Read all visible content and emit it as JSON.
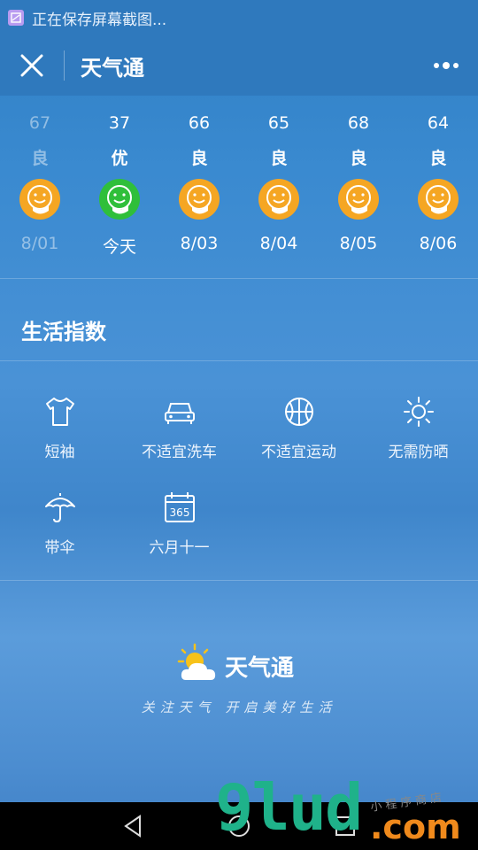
{
  "status": {
    "text": "正在保存屏幕截图..."
  },
  "nav": {
    "title": "天气通"
  },
  "forecast": [
    {
      "aqi": "67",
      "level": "良",
      "date": "8/01",
      "past": true,
      "good": false
    },
    {
      "aqi": "37",
      "level": "优",
      "date": "今天",
      "past": false,
      "good": true
    },
    {
      "aqi": "66",
      "level": "良",
      "date": "8/03",
      "past": false,
      "good": false
    },
    {
      "aqi": "65",
      "level": "良",
      "date": "8/04",
      "past": false,
      "good": false
    },
    {
      "aqi": "68",
      "level": "良",
      "date": "8/05",
      "past": false,
      "good": false
    },
    {
      "aqi": "64",
      "level": "良",
      "date": "8/06",
      "past": false,
      "good": false
    }
  ],
  "life": {
    "title": "生活指数",
    "items": [
      {
        "label": "短袖",
        "icon": "tshirt-icon"
      },
      {
        "label": "不适宜洗车",
        "icon": "car-icon"
      },
      {
        "label": "不适宜运动",
        "icon": "basketball-icon"
      },
      {
        "label": "无需防晒",
        "icon": "sun-icon"
      },
      {
        "label": "带伞",
        "icon": "umbrella-icon"
      },
      {
        "label": "六月十一",
        "icon": "calendar-icon",
        "calendar_text": "365"
      }
    ]
  },
  "brand": {
    "name": "天气通",
    "slogan": "关注天气 开启美好生活"
  },
  "watermark": {
    "main": "9lud",
    "suffix": ".com",
    "small": "小程序商店"
  },
  "colors": {
    "moderate": "#f5a623",
    "excellent": "#2fbf3a",
    "bar": "#2f79bd"
  }
}
